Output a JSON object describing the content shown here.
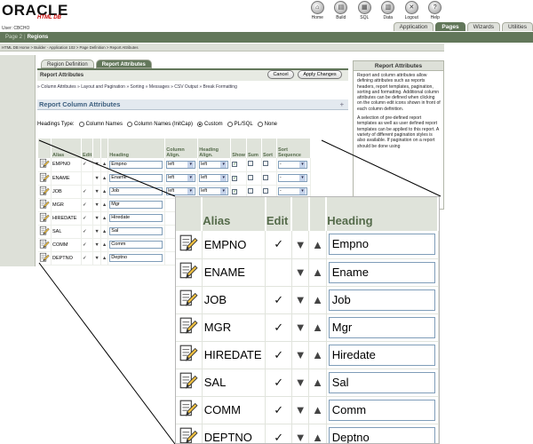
{
  "logo": {
    "main": "ORACLE",
    "sub": "HTML DB"
  },
  "user": "User: CBCHO",
  "top_icons": [
    {
      "label": "Home",
      "icon": "home-icon",
      "glyph": "⌂"
    },
    {
      "label": "Build",
      "icon": "build-icon",
      "glyph": "▤"
    },
    {
      "label": "SQL",
      "icon": "sql-icon",
      "glyph": "▦"
    },
    {
      "label": "Data",
      "icon": "data-icon",
      "glyph": "▥"
    },
    {
      "label": "Logout",
      "icon": "logout-icon",
      "glyph": "✕"
    },
    {
      "label": "Help",
      "icon": "help-icon",
      "glyph": "?"
    }
  ],
  "app_tabs": [
    "Application",
    "Pages",
    "Wizards",
    "Utilities"
  ],
  "active_app_tab": "Pages",
  "page_bar": {
    "page_label": "Page 2",
    "separator": "|",
    "region_label": "Regions"
  },
  "breadcrumb": "HTML DB Home > Builder - Application 102 > Page Definition > Report Attributes",
  "region_tabs": [
    "Region Definition",
    "Report Attributes"
  ],
  "region_header": "Report Attributes",
  "buttons": {
    "cancel": "Cancel",
    "apply": "Apply Changes"
  },
  "sub_links": "» Column Attributes » Layout and Pagination » Sorting » Messages » CSV Output » Break Formatting",
  "section_title": "Report Column Attributes",
  "section_toggle": "+",
  "headings_type": {
    "label": "Headings Type:",
    "options": [
      "Column Names",
      "Column Names (InitCap)",
      "Custom",
      "PL/SQL",
      "None"
    ],
    "selected": "Custom"
  },
  "columns": {
    "alias": "Alias",
    "edit": "Edit",
    "heading": "Heading",
    "col_align": "Column Align.",
    "head_align": "Heading Align.",
    "show": "Show",
    "sum": "Sum",
    "sort": "Sort",
    "sort_seq": "Sort Sequence"
  },
  "rows": [
    {
      "alias": "EMPNO",
      "edit": true,
      "heading": "Empno",
      "col_align": "left",
      "head_align": "left",
      "show": true,
      "sum": false,
      "sort": false,
      "seq": "-"
    },
    {
      "alias": "ENAME",
      "edit": false,
      "heading": "Ename",
      "col_align": "left",
      "head_align": "left",
      "show": true,
      "sum": false,
      "sort": false,
      "seq": "-"
    },
    {
      "alias": "JOB",
      "edit": true,
      "heading": "Job",
      "col_align": "left",
      "head_align": "left",
      "show": true,
      "sum": false,
      "sort": false,
      "seq": "-"
    },
    {
      "alias": "MGR",
      "edit": true,
      "heading": "Mgr"
    },
    {
      "alias": "HIREDATE",
      "edit": true,
      "heading": "Hiredate"
    },
    {
      "alias": "SAL",
      "edit": true,
      "heading": "Sal"
    },
    {
      "alias": "COMM",
      "edit": true,
      "heading": "Comm"
    },
    {
      "alias": "DEPTNO",
      "edit": true,
      "heading": "Deptno"
    }
  ],
  "help": {
    "title": "Report Attributes",
    "p1": "Report and column attributes allow defining attributes such as reports headers, report templates, pagination, sorting and formatting. Additional column attributes can be defined when clicking on the column edit icons shown in front of each column definition.",
    "p2": "A selection of pre-defined report templates as well as user defined report templates can be applied to this report. A variety of different pagination styles is also available. If pagination on a report should be done using"
  },
  "arrows": {
    "down": "▼",
    "up": "▲"
  },
  "glyphs": {
    "check": "✓",
    "toggle": "▾"
  }
}
